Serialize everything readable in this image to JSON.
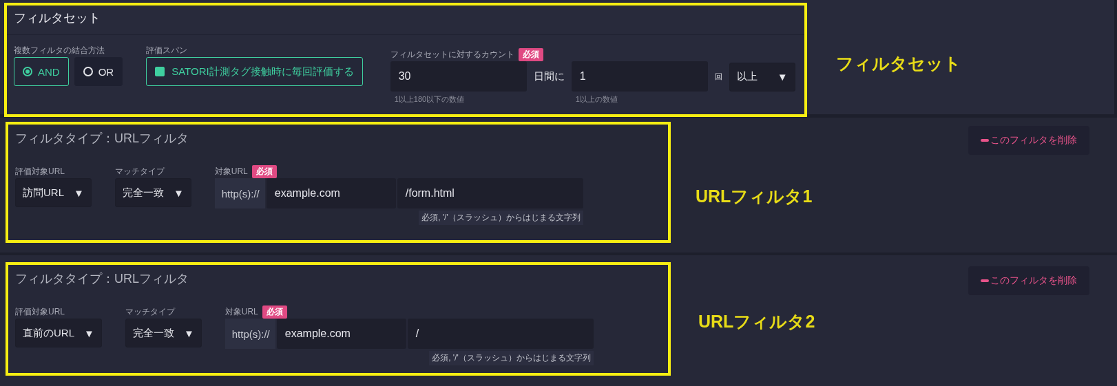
{
  "filter_set": {
    "title": "フィルタセット",
    "combine": {
      "label": "複数フィルタの結合方法",
      "options": [
        {
          "label": "AND",
          "selected": true
        },
        {
          "label": "OR",
          "selected": false
        }
      ]
    },
    "span": {
      "label": "評価スパン",
      "checkbox": {
        "label": "SATORI計測タグ接触時に毎回評価する",
        "checked": true
      }
    },
    "count": {
      "label": "フィルタセットに対するカウント",
      "badge": "必須",
      "days": {
        "value": "30",
        "hint": "1以上180以下の数値"
      },
      "days_unit": "日間に",
      "times": {
        "value": "1",
        "hint": "1以上の数値"
      },
      "times_unit": "回",
      "comparison": {
        "value": "以上",
        "arrow": "▼"
      }
    },
    "annotation": "フィルタセット"
  },
  "filters": [
    {
      "title": "フィルタタイプ：URLフィルタ",
      "delete_button": "このフィルタを削除",
      "evaluated_url": {
        "label": "評価対象URL",
        "value": "訪問URL",
        "arrow": "▼"
      },
      "match_type": {
        "label": "マッチタイプ",
        "value": "完全一致",
        "arrow": "▼"
      },
      "target_url": {
        "label": "対象URL",
        "badge": "必須",
        "prefix": "http(s)://",
        "host": "example.com",
        "path": "/form.html",
        "hint": "必須, '/'（スラッシュ）からはじまる文字列"
      },
      "annotation": "URLフィルタ1"
    },
    {
      "title": "フィルタタイプ：URLフィルタ",
      "delete_button": "このフィルタを削除",
      "evaluated_url": {
        "label": "評価対象URL",
        "value": "直前のURL",
        "arrow": "▼"
      },
      "match_type": {
        "label": "マッチタイプ",
        "value": "完全一致",
        "arrow": "▼"
      },
      "target_url": {
        "label": "対象URL",
        "badge": "必須",
        "prefix": "http(s)://",
        "host": "example.com",
        "path": "/",
        "hint": "必須, '/'（スラッシュ）からはじまる文字列"
      },
      "annotation": "URLフィルタ2"
    }
  ]
}
